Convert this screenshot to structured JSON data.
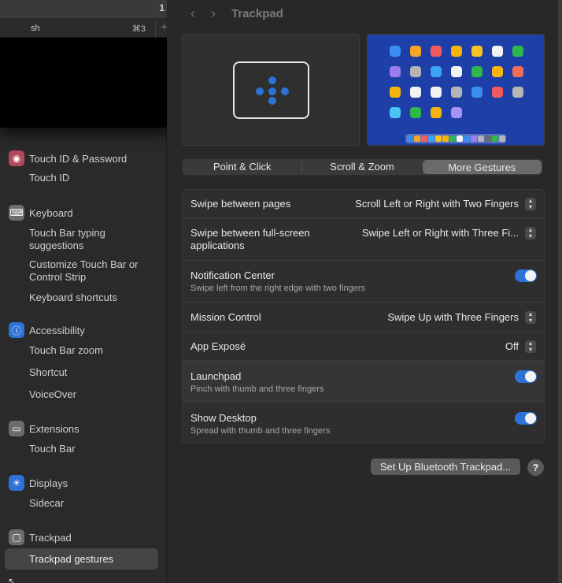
{
  "terminal": {
    "window_number": "1",
    "tab_name": "sh",
    "tab_shortcut": "⌘3",
    "new_tab_symbol": "+"
  },
  "sidebar": {
    "sections": [
      {
        "label": "Touch ID & Password",
        "icon": "fingerprint-icon",
        "color": "#b24a5b",
        "items": [
          "Touch ID"
        ]
      },
      {
        "label": "Keyboard",
        "icon": "keyboard-icon",
        "color": "#6c6c6c",
        "items": [
          "Touch Bar typing suggestions",
          "Customize Touch Bar or Control Strip",
          "Keyboard shortcuts"
        ]
      },
      {
        "label": "Accessibility",
        "icon": "accessibility-icon",
        "color": "#2d72d6",
        "items": [
          "Touch Bar zoom",
          "Shortcut",
          "VoiceOver"
        ]
      },
      {
        "label": "Extensions",
        "icon": "extensions-icon",
        "color": "#6c6c6c",
        "items": [
          "Touch Bar"
        ]
      },
      {
        "label": "Displays",
        "icon": "displays-icon",
        "color": "#2d72d6",
        "items": [
          "Sidecar"
        ]
      },
      {
        "label": "Trackpad",
        "icon": "trackpad-icon",
        "color": "#6c6c6c",
        "items": [
          "Trackpad gestures"
        ]
      }
    ],
    "selected_item": "Trackpad gestures"
  },
  "main": {
    "title": "Trackpad",
    "back_symbol": "‹",
    "forward_symbol": "›",
    "tabs": [
      "Point & Click",
      "Scroll & Zoom",
      "More Gestures"
    ],
    "active_tab": "More Gestures",
    "settings": [
      {
        "label": "Swipe between pages",
        "value": "Scroll Left or Right with Two Fingers",
        "control": "popup"
      },
      {
        "label": "Swipe between full-screen applications",
        "value": "Swipe Left or Right with Three Fi...",
        "control": "popup"
      },
      {
        "label": "Notification Center",
        "sub": "Swipe left from the right edge with two fingers",
        "control": "toggle",
        "on": true
      },
      {
        "label": "Mission Control",
        "value": "Swipe Up with Three Fingers",
        "control": "popup"
      },
      {
        "label": "App Exposé",
        "value": "Off",
        "control": "popup"
      },
      {
        "label": "Launchpad",
        "sub": "Pinch with thumb and three fingers",
        "control": "toggle",
        "on": true
      },
      {
        "label": "Show Desktop",
        "sub": "Spread with thumb and three fingers",
        "control": "toggle",
        "on": true
      }
    ],
    "bluetooth_button": "Set Up Bluetooth Trackpad...",
    "help_button": "?"
  },
  "colors": {
    "accent": "#2d72d6",
    "launchpad_bg": "#1e3fa8"
  }
}
